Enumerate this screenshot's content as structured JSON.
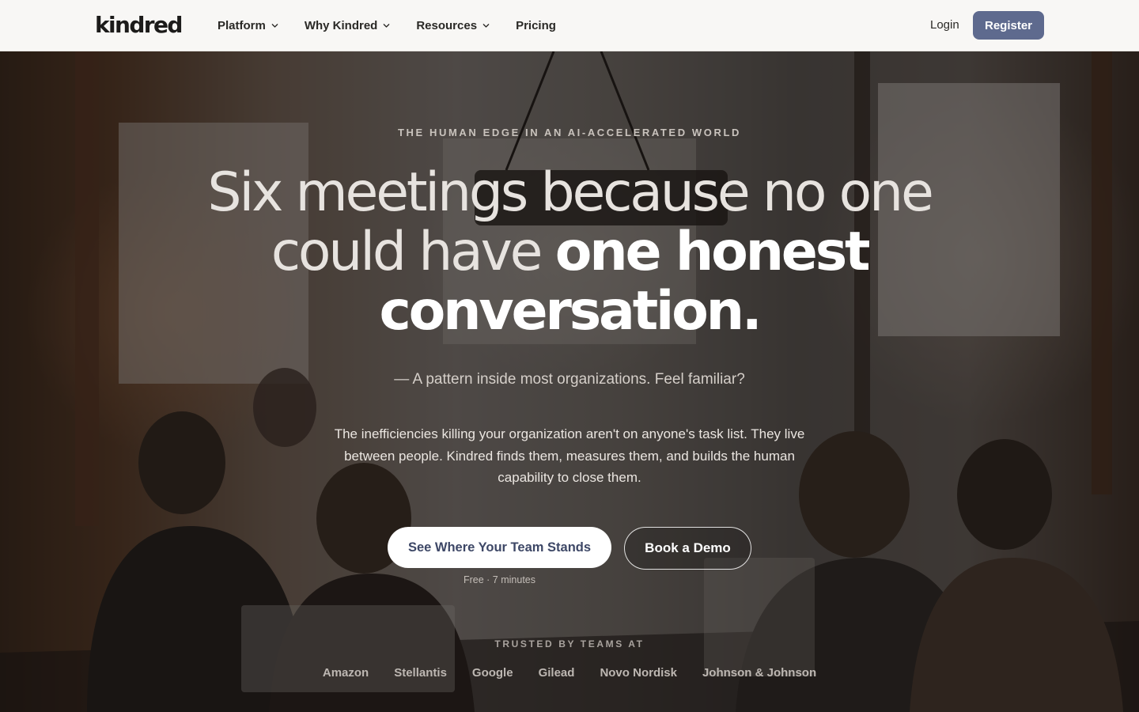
{
  "brand": {
    "logo": "kindred"
  },
  "nav": {
    "items": [
      {
        "label": "Platform",
        "has_dropdown": true
      },
      {
        "label": "Why Kindred",
        "has_dropdown": true
      },
      {
        "label": "Resources",
        "has_dropdown": true
      },
      {
        "label": "Pricing",
        "has_dropdown": false
      }
    ],
    "login": "Login",
    "register": "Register"
  },
  "hero": {
    "eyebrow": "THE HUMAN EDGE IN AN AI-ACCELERATED WORLD",
    "headline_light": "Six meetings because no one could have ",
    "headline_strong": "one honest conversation.",
    "subline": "— A pattern inside most organizations. Feel familiar?",
    "body": "The inefficiencies killing your organization aren't on anyone's task list. They live between people. Kindred finds them, measures them, and builds the human capability to close them.",
    "cta_primary": "See Where Your Team Stands",
    "cta_secondary": "Book a Demo",
    "cta_note": "Free · 7 minutes"
  },
  "trusted": {
    "label": "TRUSTED BY TEAMS AT",
    "companies": [
      "Amazon",
      "Stellantis",
      "Google",
      "Gilead",
      "Novo Nordisk",
      "Johnson & Johnson"
    ]
  },
  "colors": {
    "register_bg": "#5e6a8e",
    "primary_cta_text": "#3d4766",
    "nav_bg": "#f8f7f5"
  }
}
